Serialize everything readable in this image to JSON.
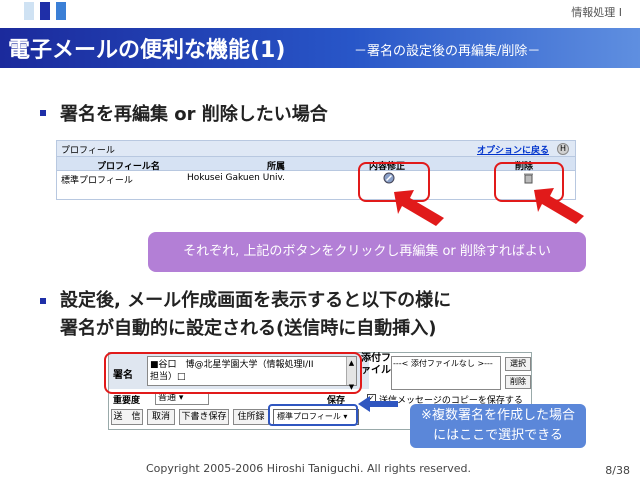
{
  "header": {
    "course": "情報処理 I",
    "title": "電子メールの便利な機能(1)",
    "subtitle": "－署名の設定後の再編集/削除－"
  },
  "bullets": [
    "署名を再編集 or 削除したい場合",
    "設定後, メール作成画面を表示すると以下の様に",
    "署名が自動的に設定される(送信時に自動挿入)"
  ],
  "profile_table": {
    "title": "プロフィール",
    "back_link": "オプションに戻る",
    "help": "H",
    "columns": [
      "プロフィール名",
      "所属",
      "内容修正",
      "削除"
    ],
    "rows": [
      {
        "name": "標準プロフィール",
        "affiliation": "Hokusei Gakuen Univ."
      }
    ]
  },
  "callout1": "それぞれ, 上記のボタンをクリックし再編集 or 削除すればよい",
  "mail": {
    "signature_label": "署名",
    "signature_text_1": "■谷口　博@北星学園大学（情報処理I/II",
    "signature_text_2": "担当）□",
    "attach_label": "添付ファイル",
    "attach_value": "---< 添付ファイルなし >---",
    "select_btn": "選択",
    "delete_btn": "削除",
    "priority_label": "重要度",
    "priority_value": "普通",
    "save_label": "保存",
    "save_check_label": "送信メッセージのコピーを保存する",
    "buttons": [
      "送　信",
      "取消",
      "下書き保存",
      "住所録"
    ],
    "profile_select": "標準プロフィール"
  },
  "callout2_line1": "※複数署名を作成した場合",
  "callout2_line2": "にはここで選択できる",
  "footer": "Copyright 2005-2006 Hiroshi Taniguchi. All rights reserved.",
  "page": "8/38",
  "colors": {
    "accent": "#1f2fa8",
    "highlight": "#e11a1a",
    "callout": "#b37fd6",
    "callout2": "#5b87d9"
  }
}
